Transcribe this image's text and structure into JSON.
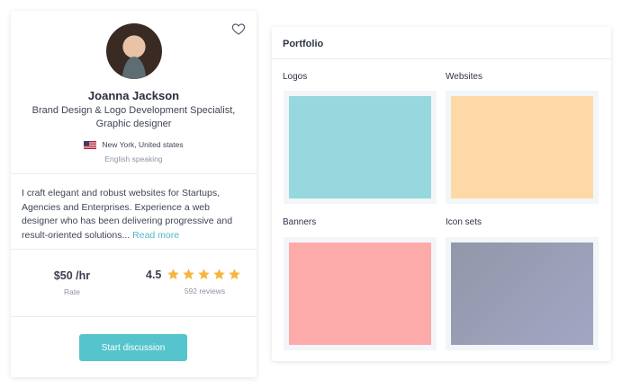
{
  "profile": {
    "name": "Joanna Jackson",
    "title": "Brand Design & Logo Development Specialist, Graphic designer",
    "location": "New York, United states",
    "language": "English speaking",
    "bio": "I craft elegant and robust websites for Startups, Agencies and Enterprises. Experience a web designer who has been delivering progressive and result-oriented solutions...",
    "read_more": "Read more",
    "rate_value": "$50 /hr",
    "rate_label": "Rate",
    "rating_value": "4.5",
    "rating_stars": 5,
    "reviews": "592 reviews",
    "cta": "Start discussion",
    "star_color": "#f4b63f",
    "accent": "#55c4cd",
    "icons": {
      "favorite": "heart-outline-icon",
      "flag": "us-flag-icon",
      "star": "star-icon"
    }
  },
  "portfolio": {
    "title": "Portfolio",
    "items": [
      {
        "label": "Logos",
        "color": "#96d8de"
      },
      {
        "label": "Websites",
        "color": "#fdd9a8"
      },
      {
        "label": "Banners",
        "color": "#fdaaaa"
      },
      {
        "label": "Icon sets",
        "color": "#9a9eb6"
      }
    ]
  }
}
